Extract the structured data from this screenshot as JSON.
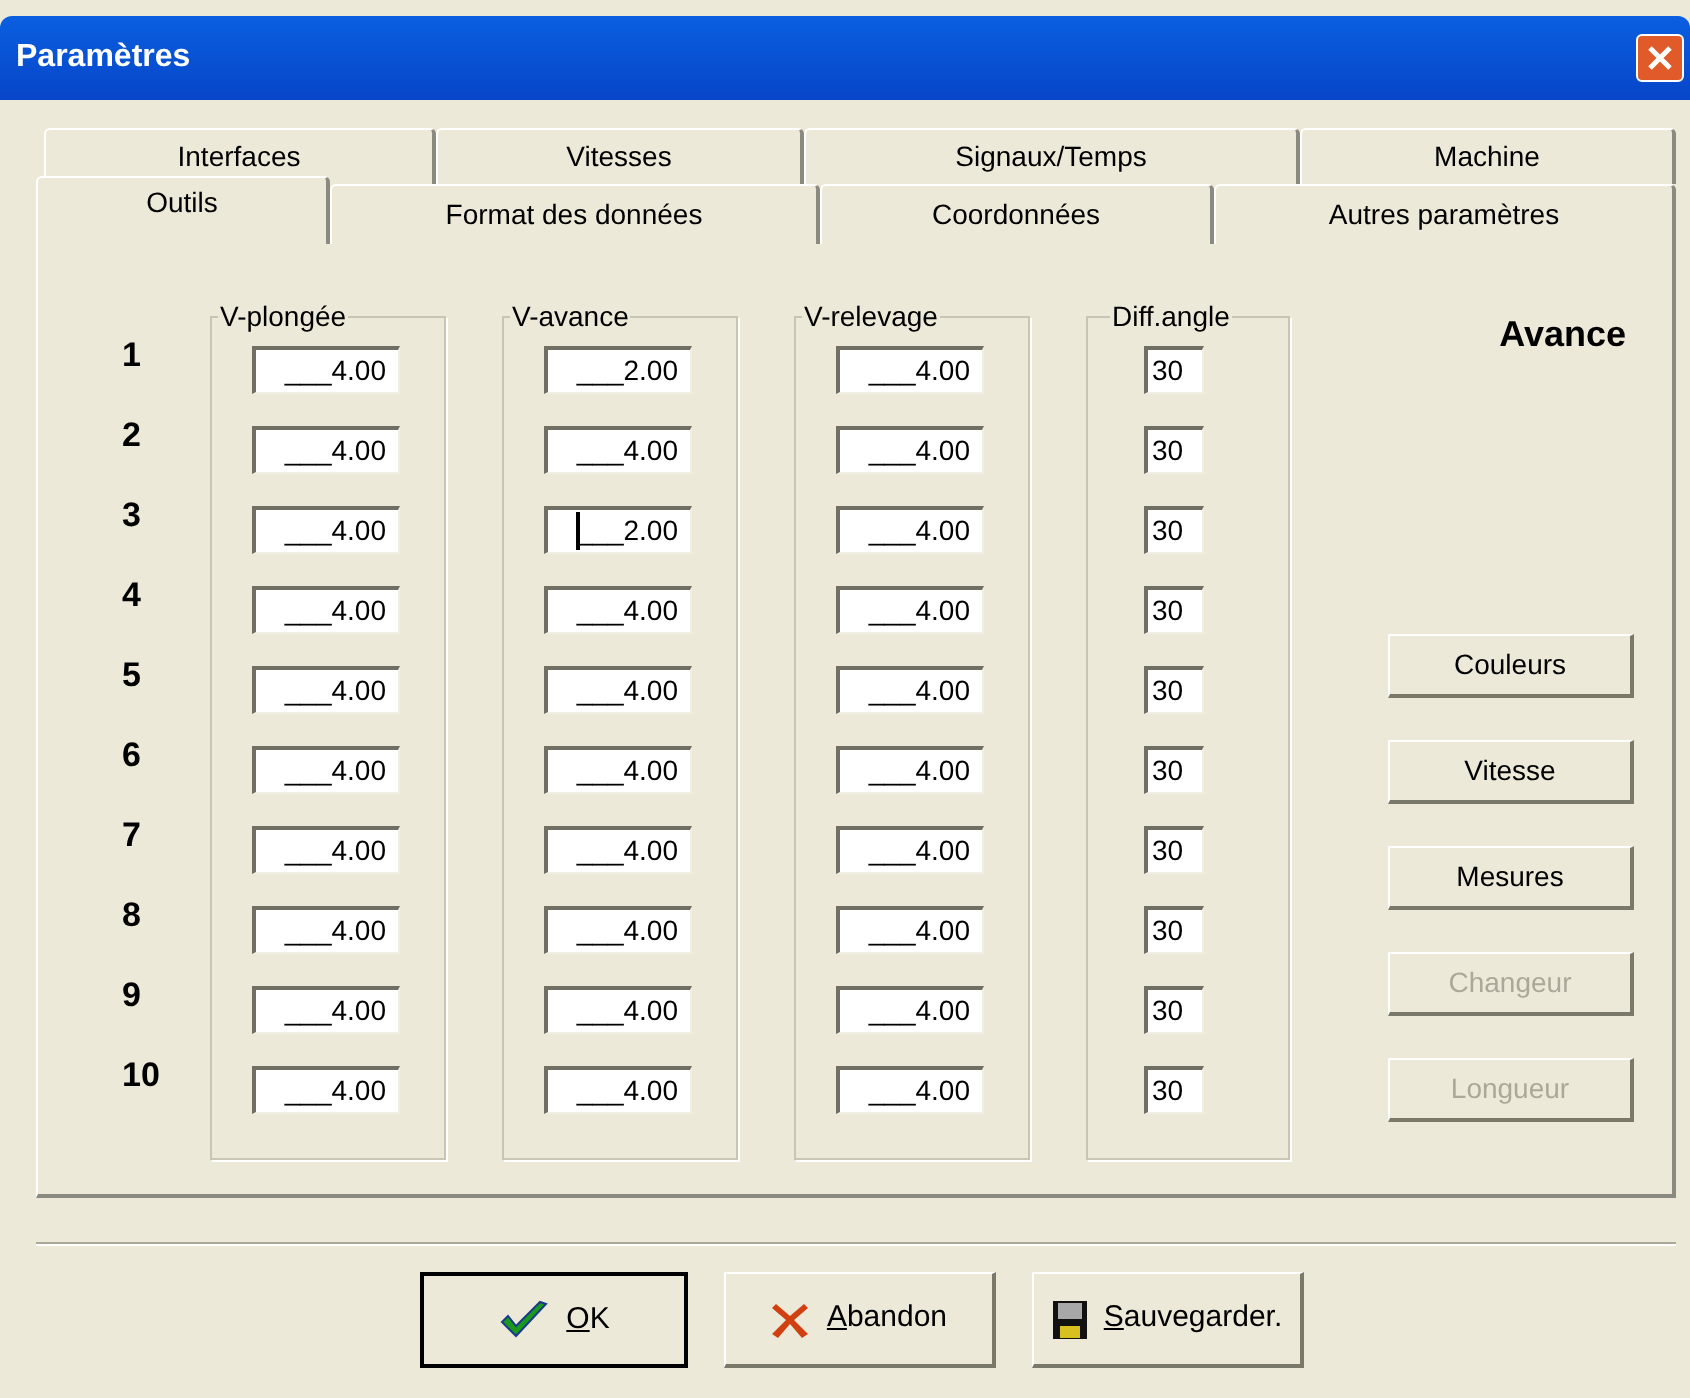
{
  "window": {
    "title": "Paramètres"
  },
  "tab_rows": [
    [
      {
        "label": "Interfaces",
        "selected": false
      },
      {
        "label": "Vitesses",
        "selected": false
      },
      {
        "label": "Signaux/Temps",
        "selected": false
      },
      {
        "label": "Machine",
        "selected": false
      }
    ],
    [
      {
        "label": "Outils",
        "selected": true
      },
      {
        "label": "Format des données",
        "selected": false
      },
      {
        "label": "Coordonnées",
        "selected": false
      },
      {
        "label": "Autres paramètres",
        "selected": false
      }
    ]
  ],
  "row_labels": [
    "1",
    "2",
    "3",
    "4",
    "5",
    "6",
    "7",
    "8",
    "9",
    "10"
  ],
  "groups": [
    {
      "title": "V-plongée",
      "narrow": false,
      "fields": [
        {
          "value": "___4.00",
          "focused": false
        },
        {
          "value": "___4.00",
          "focused": false
        },
        {
          "value": "___4.00",
          "focused": false
        },
        {
          "value": "___4.00",
          "focused": false
        },
        {
          "value": "___4.00",
          "focused": false
        },
        {
          "value": "___4.00",
          "focused": false
        },
        {
          "value": "___4.00",
          "focused": false
        },
        {
          "value": "___4.00",
          "focused": false
        },
        {
          "value": "___4.00",
          "focused": false
        },
        {
          "value": "___4.00",
          "focused": false
        }
      ]
    },
    {
      "title": "V-avance",
      "narrow": false,
      "fields": [
        {
          "value": "___2.00",
          "focused": false
        },
        {
          "value": "___4.00",
          "focused": false
        },
        {
          "value": "___2.00",
          "focused": true
        },
        {
          "value": "___4.00",
          "focused": false
        },
        {
          "value": "___4.00",
          "focused": false
        },
        {
          "value": "___4.00",
          "focused": false
        },
        {
          "value": "___4.00",
          "focused": false
        },
        {
          "value": "___4.00",
          "focused": false
        },
        {
          "value": "___4.00",
          "focused": false
        },
        {
          "value": "___4.00",
          "focused": false
        }
      ]
    },
    {
      "title": "V-relevage",
      "narrow": false,
      "fields": [
        {
          "value": "___4.00",
          "focused": false
        },
        {
          "value": "___4.00",
          "focused": false
        },
        {
          "value": "___4.00",
          "focused": false
        },
        {
          "value": "___4.00",
          "focused": false
        },
        {
          "value": "___4.00",
          "focused": false
        },
        {
          "value": "___4.00",
          "focused": false
        },
        {
          "value": "___4.00",
          "focused": false
        },
        {
          "value": "___4.00",
          "focused": false
        },
        {
          "value": "___4.00",
          "focused": false
        },
        {
          "value": "___4.00",
          "focused": false
        }
      ]
    },
    {
      "title": "Diff.angle",
      "narrow": true,
      "fields": [
        {
          "value": "30",
          "focused": false
        },
        {
          "value": "30",
          "focused": false
        },
        {
          "value": "30",
          "focused": false
        },
        {
          "value": "30",
          "focused": false
        },
        {
          "value": "30",
          "focused": false
        },
        {
          "value": "30",
          "focused": false
        },
        {
          "value": "30",
          "focused": false
        },
        {
          "value": "30",
          "focused": false
        },
        {
          "value": "30",
          "focused": false
        },
        {
          "value": "30",
          "focused": false
        }
      ]
    }
  ],
  "mode_label": "Avance",
  "side_buttons": [
    {
      "label": "Couleurs",
      "disabled": false
    },
    {
      "label": "Vitesse",
      "disabled": false
    },
    {
      "label": "Mesures",
      "disabled": false
    },
    {
      "label": "Changeur",
      "disabled": true
    },
    {
      "label": "Longueur",
      "disabled": true
    }
  ],
  "buttons": [
    {
      "label": "OK",
      "kind": "ok",
      "default": true,
      "underline_first": true
    },
    {
      "label": "Abandon",
      "kind": "cancel",
      "default": false,
      "underline_first": true
    },
    {
      "label": "Sauvegarder.",
      "kind": "save",
      "default": false,
      "underline_first": true
    }
  ]
}
